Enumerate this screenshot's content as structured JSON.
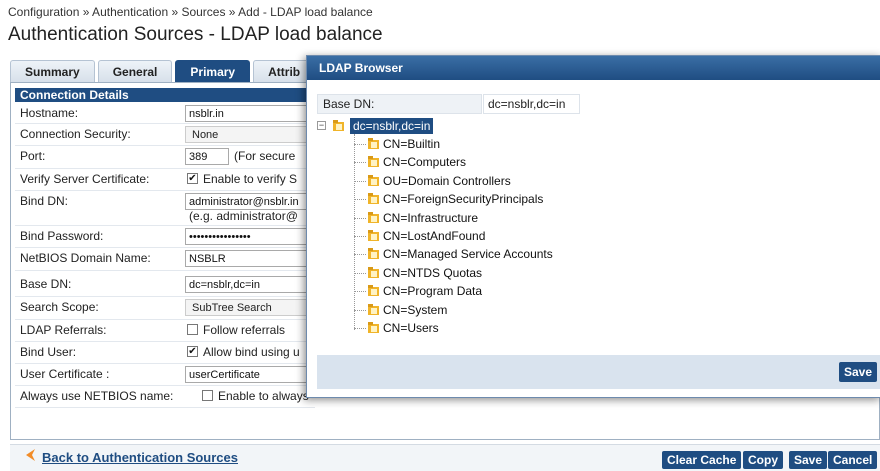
{
  "breadcrumb": "Configuration » Authentication » Sources » Add - LDAP load balance",
  "page_title": "Authentication Sources - LDAP load balance",
  "tabs": [
    "Summary",
    "General",
    "Primary",
    "Attrib"
  ],
  "section": "Connection Details",
  "fields": {
    "hostname": {
      "label": "Hostname:",
      "value": "nsblr.in"
    },
    "connection_security": {
      "label": "Connection Security:",
      "value": "None"
    },
    "port": {
      "label": "Port:",
      "value": "389",
      "note": "(For secure"
    },
    "verify_cert": {
      "label": "Verify Server Certificate:",
      "checked": true,
      "text": "Enable to verify S"
    },
    "bind_dn": {
      "label": "Bind DN:",
      "value": "administrator@nsblr.in",
      "hint": "(e.g. administrator@"
    },
    "bind_password": {
      "label": "Bind Password:",
      "value": "••••••••••••••••"
    },
    "netbios": {
      "label": "NetBIOS Domain Name:",
      "value": "NSBLR"
    },
    "base_dn": {
      "label": "Base DN:",
      "value": "dc=nsblr,dc=in"
    },
    "search_scope": {
      "label": "Search Scope:",
      "value": "SubTree Search"
    },
    "ldap_referrals": {
      "label": "LDAP Referrals:",
      "checked": false,
      "text": "Follow referrals"
    },
    "bind_user": {
      "label": "Bind User:",
      "checked": true,
      "text": "Allow bind using u"
    },
    "user_certificate": {
      "label": "User Certificate :",
      "value": "userCertificate"
    },
    "always_netbios": {
      "label": "Always use NETBIOS name:",
      "checked": false,
      "text": "Enable to always"
    }
  },
  "footer": {
    "back_link": "Back to Authentication Sources",
    "clear_cache": "Clear Cache",
    "copy": "Copy",
    "save": "Save",
    "cancel": "Cancel"
  },
  "dialog": {
    "title": "LDAP Browser",
    "base_dn_label": "Base DN:",
    "base_dn_value": "dc=nsblr,dc=in",
    "root": "dc=nsblr,dc=in",
    "expander": "−",
    "nodes": [
      "CN=Builtin",
      "CN=Computers",
      "OU=Domain Controllers",
      "CN=ForeignSecurityPrincipals",
      "CN=Infrastructure",
      "CN=LostAndFound",
      "CN=Managed Service Accounts",
      "CN=NTDS Quotas",
      "CN=Program Data",
      "CN=System",
      "CN=Users"
    ],
    "save": "Save"
  },
  "colors": {
    "accent": "#1f4d82",
    "folder": "#f0b429"
  }
}
